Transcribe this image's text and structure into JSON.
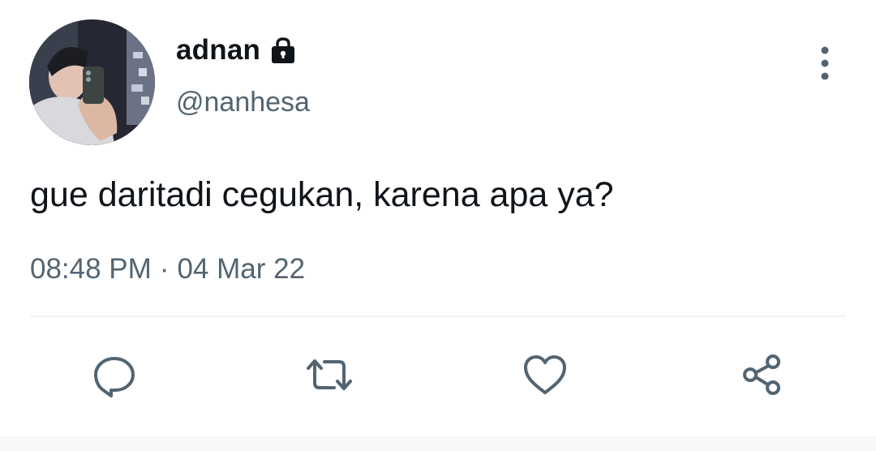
{
  "author": {
    "display_name": "adnan",
    "handle": "@nanhesa",
    "avatar_icon": "profile-photo",
    "protected_icon": "lock-icon"
  },
  "more_icon": "more-vertical-icon",
  "tweet": {
    "text": "gue daritadi cegukan, karena apa ya?",
    "time": "08:48 PM",
    "separator": "·",
    "date": "04 Mar 22"
  },
  "actions": [
    {
      "icon": "reply-icon"
    },
    {
      "icon": "retweet-icon"
    },
    {
      "icon": "like-icon"
    },
    {
      "icon": "share-icon"
    }
  ],
  "colors": {
    "text_primary": "#0f1419",
    "text_secondary": "#536471",
    "divider": "#eff3f4",
    "background": "#ffffff"
  }
}
